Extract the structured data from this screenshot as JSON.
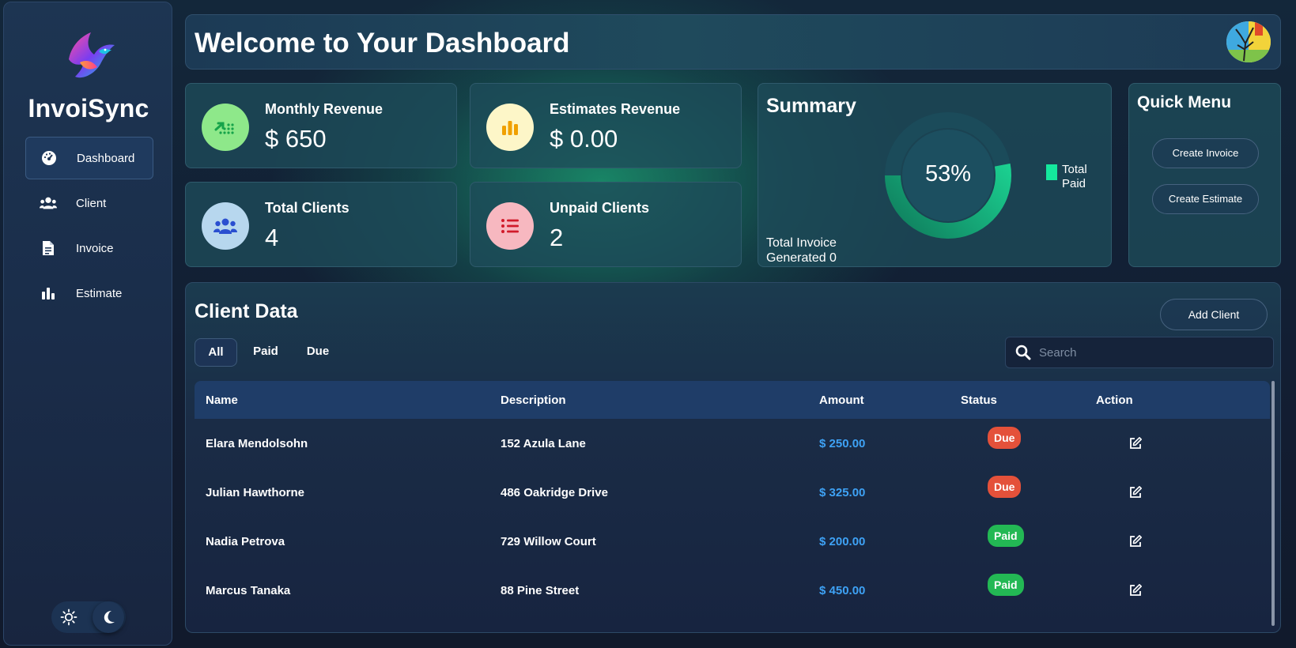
{
  "brand": {
    "name": "InvoiSync"
  },
  "sidebar": {
    "items": [
      {
        "label": "Dashboard",
        "icon": "dashboard-gauge-icon",
        "active": true
      },
      {
        "label": "Client",
        "icon": "users-icon",
        "active": false
      },
      {
        "label": "Invoice",
        "icon": "document-icon",
        "active": false
      },
      {
        "label": "Estimate",
        "icon": "bar-chart-icon",
        "active": false
      }
    ],
    "theme_toggle": {
      "light_icon": "sun-icon",
      "dark_icon": "moon-icon",
      "selected": "dark"
    }
  },
  "header": {
    "title": "Welcome to Your Dashboard",
    "avatar_icon": "tree-avatar-icon"
  },
  "stats": [
    {
      "title": "Monthly Revenue",
      "value": "$ 650",
      "icon": "trending-up-icon",
      "icon_bg": "#8ee88a",
      "icon_color": "#16a34a"
    },
    {
      "title": "Estimates Revenue",
      "value": "$ 0.00",
      "icon": "bar-chart-icon",
      "icon_bg": "#fdf6c8",
      "icon_color": "#f0a000"
    },
    {
      "title": "Total Clients",
      "value": "4",
      "icon": "users-icon",
      "icon_bg": "#b7d7ee",
      "icon_color": "#2a4fd0"
    },
    {
      "title": "Unpaid Clients",
      "value": "2",
      "icon": "list-icon",
      "icon_bg": "#f7b8c0",
      "icon_color": "#d11a2a"
    }
  ],
  "summary": {
    "title": "Summary",
    "percent_label": "53%",
    "percent": 53,
    "legend_label": "Total Paid",
    "legend_color": "#14e89d",
    "footer": "Total Invoice Generated 0"
  },
  "quick_menu": {
    "title": "Quick Menu",
    "buttons": [
      "Create Invoice",
      "Create Estimate"
    ]
  },
  "client_data": {
    "title": "Client Data",
    "add_button": "Add Client",
    "filters": [
      "All",
      "Paid",
      "Due"
    ],
    "active_filter": "All",
    "search": {
      "placeholder": "Search",
      "icon": "search-icon"
    },
    "columns": [
      "Name",
      "Description",
      "Amount",
      "Status",
      "Action"
    ],
    "rows": [
      {
        "name": "Elara Mendolsohn",
        "description": "152 Azula Lane",
        "amount": "$ 250.00",
        "status": "Due",
        "action_icon": "edit-icon"
      },
      {
        "name": "Julian Hawthorne",
        "description": "486 Oakridge Drive",
        "amount": "$ 325.00",
        "status": "Due",
        "action_icon": "edit-icon"
      },
      {
        "name": "Nadia Petrova",
        "description": "729 Willow Court",
        "amount": "$ 200.00",
        "status": "Paid",
        "action_icon": "edit-icon"
      },
      {
        "name": "Marcus Tanaka",
        "description": "88 Pine Street",
        "amount": "$ 450.00",
        "status": "Paid",
        "action_icon": "edit-icon"
      }
    ]
  }
}
